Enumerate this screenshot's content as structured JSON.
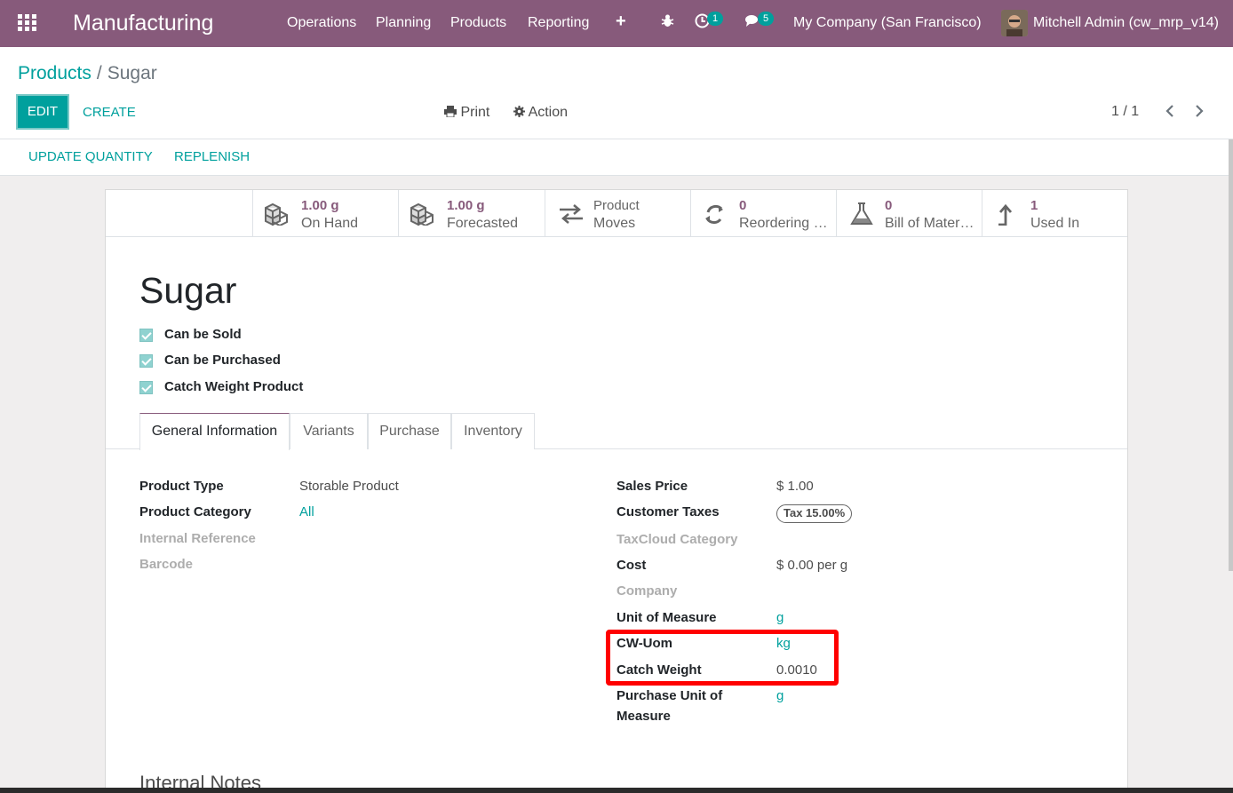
{
  "navbar": {
    "app_name": "Manufacturing",
    "menus": [
      "Operations",
      "Planning",
      "Products",
      "Reporting"
    ],
    "activity_count": "1",
    "message_count": "5",
    "company": "My Company (San Francisco)",
    "user": "Mitchell Admin (cw_mrp_v14)"
  },
  "breadcrumb": {
    "parent": "Products",
    "separator": "/",
    "current": "Sugar"
  },
  "control": {
    "edit_label": "EDIT",
    "create_label": "CREATE",
    "print_label": "Print",
    "action_label": "Action",
    "pager": "1 / 1"
  },
  "statusbar": {
    "update_quantity": "UPDATE QUANTITY",
    "replenish": "REPLENISH"
  },
  "smart_buttons": [
    {
      "value": "1.00 g",
      "label": "On Hand",
      "icon": "cubes-icon"
    },
    {
      "value": "1.00 g",
      "label": "Forecasted",
      "icon": "cubes-icon"
    },
    {
      "value": "Product",
      "label": "Moves",
      "icon": "exchange-icon"
    },
    {
      "value": "0",
      "label": "Reordering Rules",
      "icon": "refresh-icon"
    },
    {
      "value": "0",
      "label": "Bill of Materials",
      "icon": "flask-icon"
    },
    {
      "value": "1",
      "label": "Used In",
      "icon": "level-up-icon"
    }
  ],
  "product": {
    "name": "Sugar",
    "checkboxes": [
      "Can be Sold",
      "Can be Purchased",
      "Catch Weight Product"
    ]
  },
  "tabs": [
    "General Information",
    "Variants",
    "Purchase",
    "Inventory"
  ],
  "fields_left": [
    {
      "label": "Product Type",
      "value": "Storable Product"
    },
    {
      "label": "Product Category",
      "value": "All"
    },
    {
      "label": "Internal Reference",
      "value": ""
    },
    {
      "label": "Barcode",
      "value": ""
    }
  ],
  "fields_right": {
    "sales_price_label": "Sales Price",
    "sales_price": "$ 1.00",
    "customer_taxes_label": "Customer Taxes",
    "customer_taxes": "Tax 15.00%",
    "taxcloud_label": "TaxCloud Category",
    "cost_label": "Cost",
    "cost": "$ 0.00",
    "cost_unit": "per g",
    "company_label": "Company",
    "uom_label": "Unit of Measure",
    "uom": "g",
    "cw_uom_label": "CW-Uom",
    "cw_uom": "kg",
    "catch_weight_label": "Catch Weight",
    "catch_weight": "0.0010",
    "purchase_uom_label_1": "Purchase Unit of",
    "purchase_uom_label_2": "Measure",
    "purchase_uom": "g"
  },
  "notes_title": "Internal Notes",
  "colors": {
    "brand": "#875a7b",
    "accent": "#00a09d",
    "highlight": "#ff0000"
  }
}
